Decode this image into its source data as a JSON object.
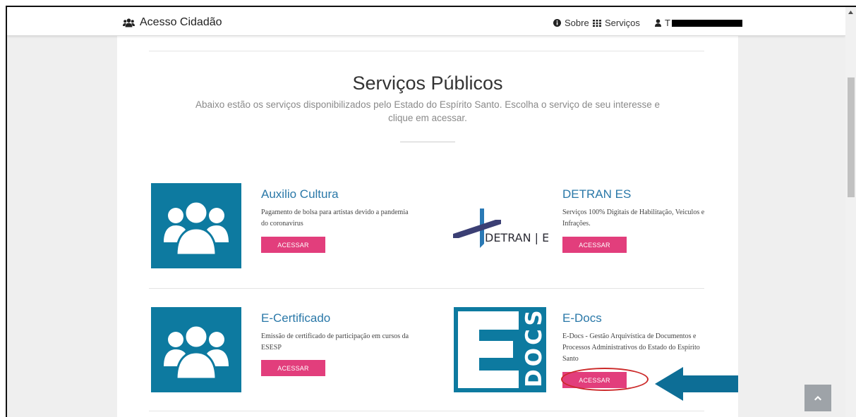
{
  "navbar": {
    "brand": "Acesso Cidadão",
    "sobre": "Sobre",
    "servicos": "Serviços",
    "user_initial": "T"
  },
  "page": {
    "title": "Serviços Públicos",
    "subtitle": "Abaixo estão os serviços disponibilizados pelo Estado do Espírito Santo. Escolha o serviço de seu interesse e clique em acessar."
  },
  "services": [
    {
      "title": "Auxilio Cultura",
      "description": "Pagamento de bolsa para artistas devido a pandemia do coronavirus",
      "button": "ACESSAR"
    },
    {
      "title": "DETRAN ES",
      "description": "Serviços 100% Digitais de Habilitação, Veiculos e Infrações.",
      "button": "ACESSAR",
      "logo_text": "DETRAN | ES"
    },
    {
      "title": "E-Certificado",
      "description": "Emissão de certificado de participação em cursos da ESESP",
      "button": "ACESSAR"
    },
    {
      "title": "E-Docs",
      "description": "E-Docs - Gestão Arquivística de Documentos e Processos Administrativos do Estado do Espírito Santo",
      "button": "ACESSAR",
      "logo_text": "E DOCS"
    }
  ],
  "colors": {
    "accent_button": "#e23e7c",
    "card_blue": "#0d7aa0",
    "title_blue": "#2a78a8",
    "annotation_red": "#cc2a2a",
    "annotation_arrow": "#0d6e96"
  },
  "icons": {
    "brand": "users-icon",
    "sobre": "info-circle-icon",
    "servicos": "grid-icon",
    "user": "user-icon",
    "back_to_top": "chevron-up-icon"
  }
}
